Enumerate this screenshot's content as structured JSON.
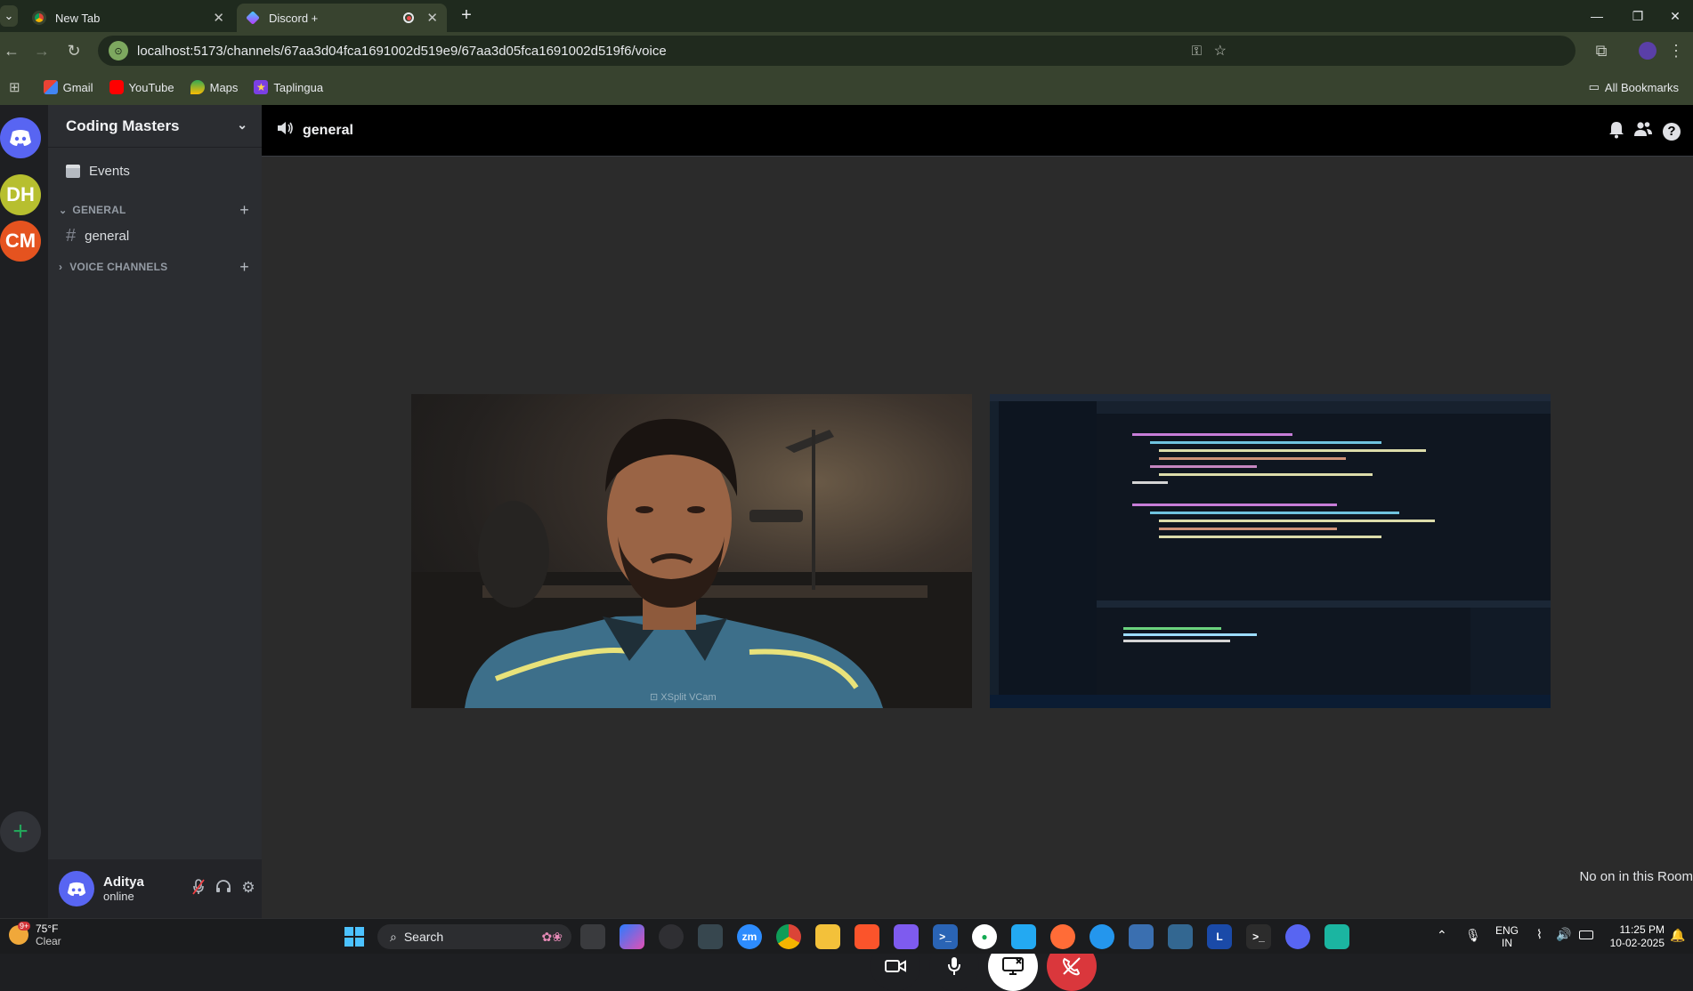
{
  "browser": {
    "tabs": [
      {
        "title": "New Tab"
      },
      {
        "title": "Discord +"
      }
    ],
    "url": "localhost:5173/channels/67aa3d04fca1691002d519e9/67aa3d05fca1691002d519f6/voice",
    "bookmarks": [
      "Gmail",
      "YouTube",
      "Maps",
      "Taplingua"
    ],
    "all_bookmarks": "All Bookmarks"
  },
  "servers": [
    "DH",
    "CM"
  ],
  "server": {
    "name": "Coding Masters",
    "events_label": "Events",
    "categories": [
      {
        "name": "GENERAL",
        "channels": [
          "general"
        ]
      },
      {
        "name": "VOICE CHANNELS",
        "channels": []
      }
    ]
  },
  "user": {
    "name": "Aditya",
    "status": "online"
  },
  "channel": {
    "name": "general"
  },
  "stage": {
    "tiles": [
      "camera",
      "screen-share"
    ],
    "camera_watermark": "XSplit VCam",
    "empty_room_text": "No on in this Room"
  },
  "controls": [
    "camera",
    "microphone",
    "stop-share",
    "leave-call"
  ],
  "colors": {
    "leave": "#da373c",
    "share_active": "#ffffff",
    "brand": "#5865f2"
  },
  "taskbar": {
    "weather_temp": "75°F",
    "weather_desc": "Clear",
    "search_placeholder": "Search",
    "lang": "ENG",
    "region": "IN",
    "time": "11:25 PM",
    "date": "10-02-2025",
    "badge": "9+"
  }
}
